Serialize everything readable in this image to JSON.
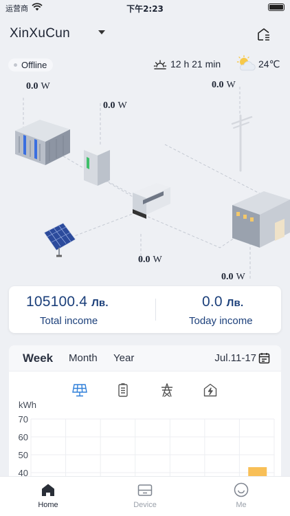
{
  "status_bar": {
    "carrier": "运营商",
    "time": "下午2:23"
  },
  "header": {
    "station_name": "XinXuCun"
  },
  "info": {
    "status": "Offline",
    "daylight": "12 h 21 min",
    "temperature": "24℃"
  },
  "flow": {
    "battery_power": "0.0",
    "inverter_power": "0.0",
    "grid_power": "0.0",
    "pv_power": "0.0",
    "load_power": "0.0",
    "unit": "W"
  },
  "income": {
    "total_value": "105100.4",
    "total_currency": "Лв.",
    "total_label": "Total income",
    "today_value": "0.0",
    "today_currency": "Лв.",
    "today_label": "Today income"
  },
  "chart_tabs": {
    "week": "Week",
    "month": "Month",
    "year": "Year",
    "active": "Week"
  },
  "chart_period": "Jul.11-17",
  "chart_metric_icons": [
    "solar-panel-icon",
    "battery-clipboard-icon",
    "power-tower-icon",
    "lightning-house-icon"
  ],
  "chart_data": {
    "type": "bar",
    "ylabel": "kWh",
    "y_ticks": [
      "70",
      "60",
      "50",
      "40"
    ],
    "y_visible_range": [
      38,
      72
    ],
    "categories": [
      "",
      "",
      "",
      "",
      "",
      "",
      ""
    ],
    "values": [
      0,
      0,
      0,
      0,
      0,
      0,
      40
    ],
    "bar_color": "#f8bf57"
  },
  "tabbar": {
    "home": "Home",
    "device": "Device",
    "me": "Me"
  },
  "colors": {
    "accent": "#1b3f7a",
    "active_metric": "#2e7fd9",
    "bar": "#f8bf57"
  }
}
